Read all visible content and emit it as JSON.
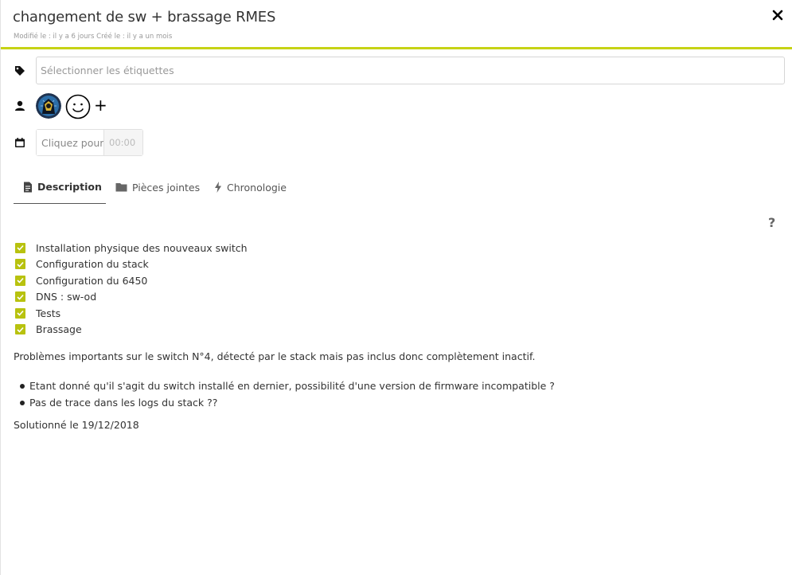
{
  "card": {
    "title": "changement de sw + brassage RMES",
    "meta": "Modifié le : il y a 6 jours Créé le : il y a un mois",
    "close_label": "✕"
  },
  "labels": {
    "placeholder": "Sélectionner les étiquettes",
    "icon": "tag-icon"
  },
  "members": {
    "icon": "user-icon",
    "add_label": "+"
  },
  "due_date": {
    "icon": "calendar-icon",
    "date_placeholder": "Cliquez pour",
    "time_placeholder": "00:00"
  },
  "tabs": [
    {
      "label": "Description",
      "icon": "document-icon",
      "active": true
    },
    {
      "label": "Pièces jointes",
      "icon": "folder-icon",
      "active": false
    },
    {
      "label": "Chronologie",
      "icon": "bolt-icon",
      "active": false
    }
  ],
  "help_label": "?",
  "description": {
    "checklist": [
      "Installation physique des nouveaux switch",
      "Configuration du stack",
      "Configuration du 6450",
      "DNS : sw-od",
      "Tests",
      "Brassage"
    ],
    "paragraph": "Problèmes importants sur le switch N°4, détecté par le stack mais pas inclus donc complètement inactif.",
    "bullets": [
      "Etant donné qu'il s'agit du switch installé en dernier, possibilité d'une version de firmware incompatible ?",
      "Pas de trace dans les logs du stack ??"
    ],
    "footer": "Solutionné le 19/12/2018"
  },
  "colors": {
    "accent": "#c6d315",
    "checkbox": "#b8c20f"
  }
}
